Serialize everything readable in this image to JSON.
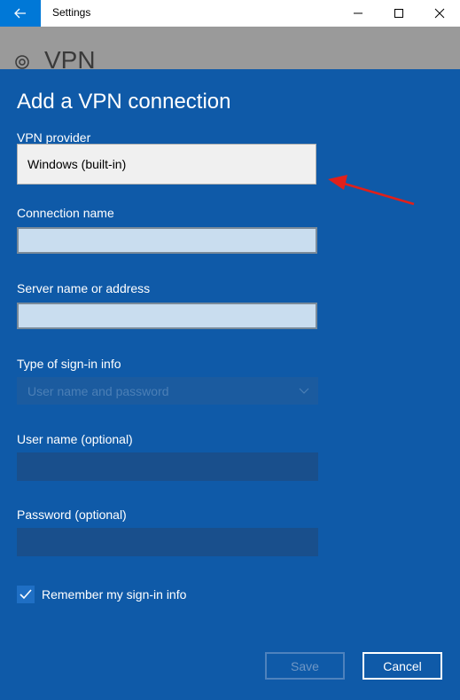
{
  "window": {
    "title": "Settings",
    "accent": "#0078d7"
  },
  "background_page": {
    "title": "VPN"
  },
  "dialog": {
    "title": "Add a VPN connection",
    "background": "#0f5aa8",
    "vpn_provider": {
      "label": "VPN provider",
      "value": "Windows (built-in)"
    },
    "connection_name": {
      "label": "Connection name",
      "value": ""
    },
    "server": {
      "label": "Server name or address",
      "value": ""
    },
    "sign_in_type": {
      "label": "Type of sign-in info",
      "value": "User name and password"
    },
    "username": {
      "label": "User name (optional)",
      "value": ""
    },
    "password": {
      "label": "Password (optional)",
      "value": ""
    },
    "remember": {
      "label": "Remember my sign-in info",
      "checked": true
    },
    "save_label": "Save",
    "cancel_label": "Cancel"
  },
  "annotation": {
    "arrow_color": "#e0201a"
  }
}
